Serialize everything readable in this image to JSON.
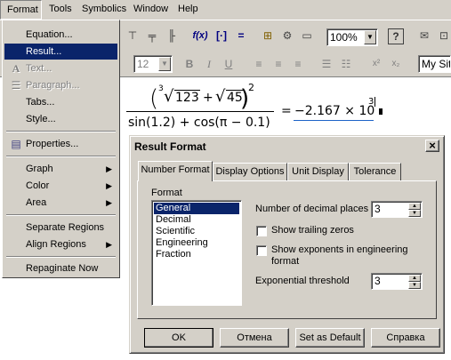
{
  "menubar": {
    "items": [
      {
        "label": "Format"
      },
      {
        "label": "Tools"
      },
      {
        "label": "Symbolics"
      },
      {
        "label": "Window"
      },
      {
        "label": "Help"
      }
    ]
  },
  "toolbar": {
    "zoom_value": "100%",
    "font_size_value": "12",
    "style_value": "My Site",
    "bold": "B",
    "italic": "I",
    "underline": "U",
    "superscript": "x²",
    "subscript": "x₂",
    "fx": "f(x)"
  },
  "format_menu": {
    "items": [
      {
        "label": "Equation...",
        "state": "normal"
      },
      {
        "label": "Result...",
        "state": "selected"
      },
      {
        "label": "Text...",
        "state": "disabled"
      },
      {
        "label": "Paragraph...",
        "state": "disabled"
      },
      {
        "label": "Tabs...",
        "state": "normal"
      },
      {
        "label": "Style...",
        "state": "normal"
      },
      {
        "label": "Properties...",
        "state": "normal"
      },
      {
        "label": "Graph",
        "state": "submenu"
      },
      {
        "label": "Color",
        "state": "submenu"
      },
      {
        "label": "Area",
        "state": "submenu"
      },
      {
        "label": "Separate Regions",
        "state": "normal"
      },
      {
        "label": "Align Regions",
        "state": "submenu"
      },
      {
        "label": "Repaginate Now",
        "state": "normal"
      }
    ]
  },
  "equation": {
    "root_index": "3",
    "radicand1": "123",
    "plus": "+",
    "radicand2": "45",
    "exponent": "2",
    "denominator": "sin(1.2) + cos(π − 0.1)",
    "equals": "=",
    "result_mantissa": "−2.167 × 10",
    "result_exponent": "3"
  },
  "dialog": {
    "title": "Result Format",
    "close": "×",
    "tabs": [
      "Number Format",
      "Display Options",
      "Unit Display",
      "Tolerance"
    ],
    "format_label": "Format",
    "format_options": [
      "General",
      "Decimal",
      "Scientific",
      "Engineering",
      "Fraction"
    ],
    "selected_format": "General",
    "decimal_places_label": "Number of decimal places",
    "decimal_places_value": "3",
    "show_trailing_zeros_label": "Show trailing zeros",
    "show_exponents_label_line1": "Show exponents in engineering",
    "show_exponents_label_line2": "format",
    "exp_threshold_label": "Exponential threshold",
    "exp_threshold_value": "3",
    "buttons": {
      "ok": "OK",
      "cancel": "Отмена",
      "set_default": "Set as Default",
      "help": "Справка"
    }
  }
}
